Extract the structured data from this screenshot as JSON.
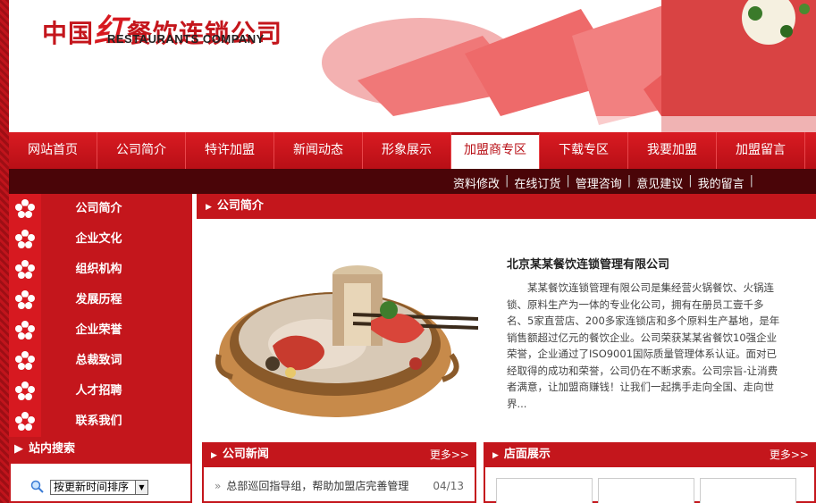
{
  "header": {
    "logo_cn_part1": "中国",
    "logo_cn_big": "红",
    "logo_cn_part2": "餐饮连锁公司",
    "logo_en": "RESTAURANTS COMPANY"
  },
  "nav": {
    "items": [
      "网站首页",
      "公司简介",
      "特许加盟",
      "新闻动态",
      "形象展示",
      "加盟商专区",
      "下载专区",
      "我要加盟",
      "加盟留言"
    ],
    "active_index": 5
  },
  "subnav": {
    "links": [
      "资料修改",
      "在线订货",
      "管理咨询",
      "意见建议",
      "我的留言"
    ]
  },
  "sidebar": {
    "items": [
      "公司简介",
      "企业文化",
      "组织机构",
      "发展历程",
      "企业荣誉",
      "总裁致词",
      "人才招聘",
      "联系我们"
    ],
    "search_title": "站内搜索",
    "sort_value": "按更新时间排序"
  },
  "main": {
    "title": "公司简介",
    "company_name": "北京某某餐饮连锁管理有限公司",
    "company_desc": "某某餐饮连锁管理有限公司是集经营火锅餐饮、火锅连锁、原料生产为一体的专业化公司，拥有在册员工壹千多名、5家直营店、200多家连锁店和多个原料生产基地，是年销售额超过亿元的餐饮企业。公司荣获某某省餐饮10强企业荣誉，企业通过了ISO9001国际质量管理体系认证。面对已经取得的成功和荣誉，公司仍在不断求索。公司宗旨-让消费者满意，让加盟商赚钱！让我们一起携手走向全国、走向世界..."
  },
  "news": {
    "title": "公司新闻",
    "more": "更多>>",
    "rows": [
      {
        "text": "总部巡回指导组，帮助加盟店完善管理",
        "date": "04/13"
      }
    ]
  },
  "shops": {
    "title": "店面展示",
    "more": "更多>>"
  },
  "colors": {
    "brand_red": "#c4161c",
    "dark_bar": "#4a0508"
  }
}
